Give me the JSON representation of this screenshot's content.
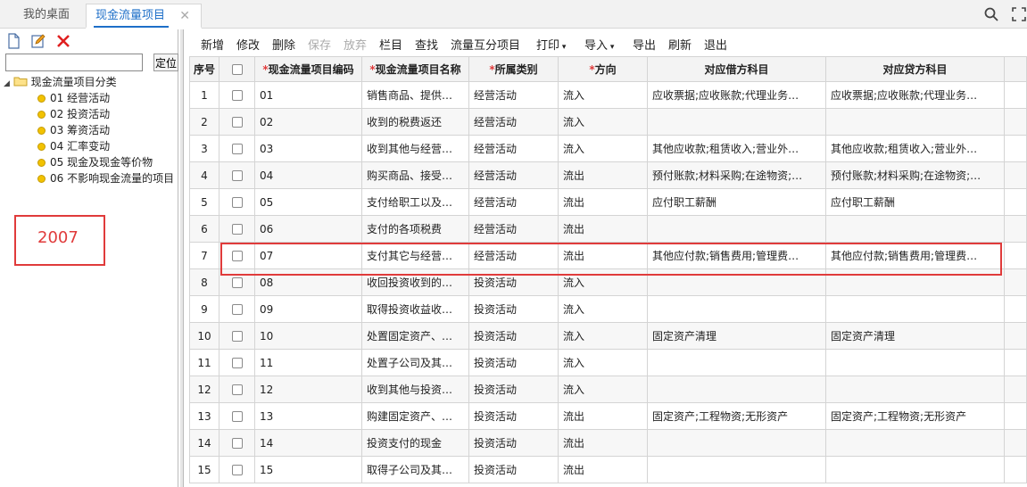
{
  "tabs": {
    "home": "我的桌面",
    "active": "现金流量项目"
  },
  "left": {
    "locate_button": "定位",
    "tree_root": "现金流量项目分类",
    "tree_items": [
      "01 经营活动",
      "02 投资活动",
      "03 筹资活动",
      "04 汇率变动",
      "05 现金及现金等价物",
      "06 不影响现金流量的项目"
    ],
    "annotation": "2007"
  },
  "toolbar": {
    "add": "新增",
    "edit": "修改",
    "delete": "删除",
    "save": "保存",
    "discard": "放弃",
    "columns": "栏目",
    "find": "查找",
    "cash_flow_items": "流量互分项目",
    "print": "打印",
    "import": "导入",
    "export": "导出",
    "refresh": "刷新",
    "exit": "退出"
  },
  "table": {
    "headers": {
      "seq": "序号",
      "code": "现金流量项目编码",
      "name": "现金流量项目名称",
      "category": "所属类别",
      "direction": "方向",
      "debit": "对应借方科目",
      "credit": "对应贷方科目"
    },
    "rows": [
      {
        "seq": "1",
        "code": "01",
        "name": "销售商品、提供…",
        "category": "经营活动",
        "direction": "流入",
        "debit": "应收票据;应收账款;代理业务…",
        "credit": "应收票据;应收账款;代理业务…"
      },
      {
        "seq": "2",
        "code": "02",
        "name": "收到的税费返还",
        "category": "经营活动",
        "direction": "流入",
        "debit": "",
        "credit": ""
      },
      {
        "seq": "3",
        "code": "03",
        "name": "收到其他与经营…",
        "category": "经营活动",
        "direction": "流入",
        "debit": "其他应收款;租赁收入;营业外…",
        "credit": "其他应收款;租赁收入;营业外…"
      },
      {
        "seq": "4",
        "code": "04",
        "name": "购买商品、接受…",
        "category": "经营活动",
        "direction": "流出",
        "debit": "预付账款;材料采购;在途物资;…",
        "credit": "预付账款;材料采购;在途物资;…"
      },
      {
        "seq": "5",
        "code": "05",
        "name": "支付给职工以及…",
        "category": "经营活动",
        "direction": "流出",
        "debit": "应付职工薪酬",
        "credit": "应付职工薪酬"
      },
      {
        "seq": "6",
        "code": "06",
        "name": "支付的各项税费",
        "category": "经营活动",
        "direction": "流出",
        "debit": "",
        "credit": ""
      },
      {
        "seq": "7",
        "code": "07",
        "name": "支付其它与经营…",
        "category": "经营活动",
        "direction": "流出",
        "debit": "其他应付款;销售费用;管理费…",
        "credit": "其他应付款;销售费用;管理费…"
      },
      {
        "seq": "8",
        "code": "08",
        "name": "收回投资收到的…",
        "category": "投资活动",
        "direction": "流入",
        "debit": "",
        "credit": ""
      },
      {
        "seq": "9",
        "code": "09",
        "name": "取得投资收益收…",
        "category": "投资活动",
        "direction": "流入",
        "debit": "",
        "credit": ""
      },
      {
        "seq": "10",
        "code": "10",
        "name": "处置固定资产、…",
        "category": "投资活动",
        "direction": "流入",
        "debit": "固定资产清理",
        "credit": "固定资产清理"
      },
      {
        "seq": "11",
        "code": "11",
        "name": "处置子公司及其…",
        "category": "投资活动",
        "direction": "流入",
        "debit": "",
        "credit": ""
      },
      {
        "seq": "12",
        "code": "12",
        "name": "收到其他与投资…",
        "category": "投资活动",
        "direction": "流入",
        "debit": "",
        "credit": ""
      },
      {
        "seq": "13",
        "code": "13",
        "name": "购建固定资产、…",
        "category": "投资活动",
        "direction": "流出",
        "debit": "固定资产;工程物资;无形资产",
        "credit": "固定资产;工程物资;无形资产"
      },
      {
        "seq": "14",
        "code": "14",
        "name": "投资支付的现金",
        "category": "投资活动",
        "direction": "流出",
        "debit": "",
        "credit": ""
      },
      {
        "seq": "15",
        "code": "15",
        "name": "取得子公司及其…",
        "category": "投资活动",
        "direction": "流出",
        "debit": "",
        "credit": ""
      }
    ]
  }
}
